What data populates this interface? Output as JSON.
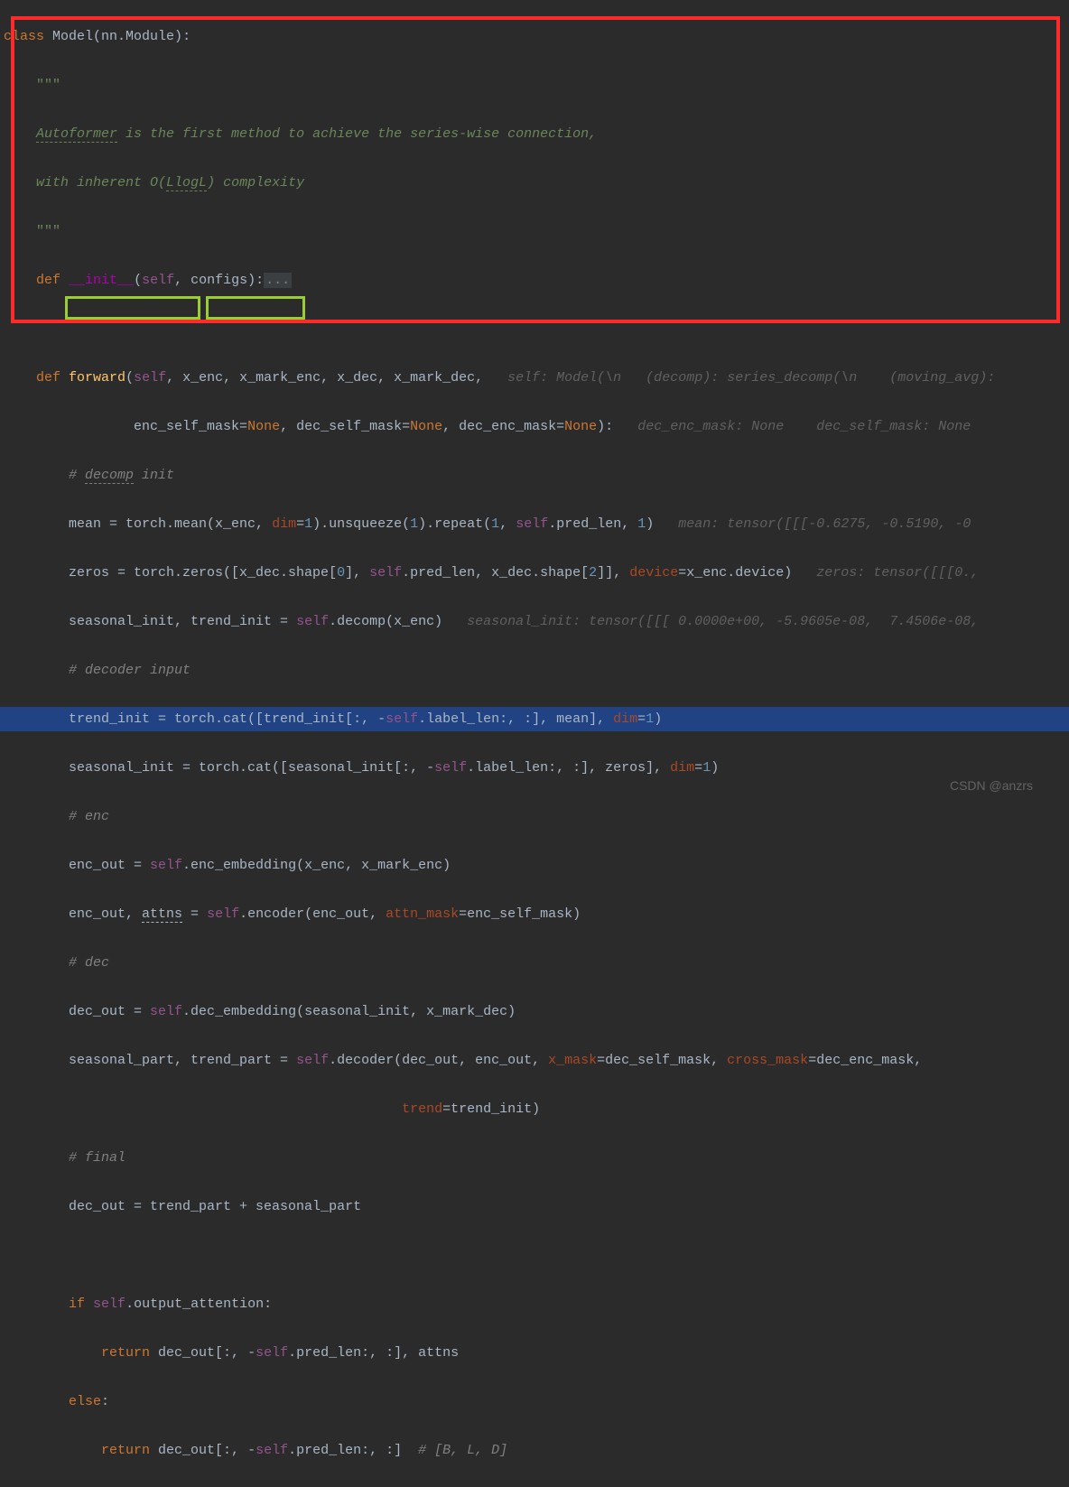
{
  "lines": {
    "class_def": {
      "kw": "class",
      "name": "Model",
      "base": "(nn.Module):"
    },
    "docq1": "\"\"\"",
    "doc1a": "Autoformer",
    "doc1b": " is the first method to achieve the series-wise connection,",
    "doc2a": "with inherent O(",
    "doc2b": "LlogL",
    "doc2c": ") complexity",
    "docq2": "\"\"\"",
    "init_def": {
      "kw": "def",
      "name": "__init__",
      "params": "(",
      "self": "self",
      "rest": ", configs):",
      "fold": "..."
    },
    "fwd_def": {
      "kw": "def",
      "name": "forward",
      "open": "(",
      "self": "self",
      "params1": ", x_enc, x_mark_enc, x_dec, x_mark_dec,",
      "hint1": "   self: Model(\\n   (decomp): series_decomp(\\n    (moving_avg):",
      "params2_a": "enc_self_mask=",
      "none1": "None",
      "c1": ", dec_self_mask=",
      "none2": "None",
      "c2": ", dec_enc_mask=",
      "none3": "None",
      "close": "):",
      "hint2": "   dec_enc_mask: None    dec_self_mask: None"
    },
    "decomp_comment": "# ",
    "decomp_word": "decomp",
    "decomp_rest": " init",
    "mean_line": {
      "a": "mean = torch.mean(x_enc, ",
      "dim": "dim",
      "b": "=",
      "n1": "1",
      "c": ").unsqueeze(",
      "n2": "1",
      "d": ").repeat(",
      "n3": "1",
      "e": ", ",
      "self": "self",
      "f": ".pred_len, ",
      "n4": "1",
      "g": ")",
      "hint": "   mean: tensor([[[-0.6275, -0.5190, -0"
    },
    "zeros_line": {
      "a": "zeros = torch.zeros([x_dec.shape[",
      "n0": "0",
      "b": "], ",
      "self": "self",
      "c": ".pred_len, x_dec.shape[",
      "n2": "2",
      "d": "]], ",
      "device": "device",
      "e": "=x_enc.device)",
      "hint": "   zeros: tensor([[[0.,"
    },
    "seasonal_line": {
      "a": "seasonal_init, trend_init = ",
      "self": "self",
      "b": ".decomp(x_enc)",
      "hint": "   seasonal_init: tensor([[[ 0.0000e+00, -5.9605e-08,  7.4506e-08,"
    },
    "decoder_comment": "# decoder input",
    "trend_init": {
      "a": "trend_init = torch.cat([trend_init[:, -",
      "self": "self",
      "b": ".label_len:, :], mean], ",
      "dim": "dim",
      "c": "=",
      "n": "1",
      "d": ")"
    },
    "seasonal_init2": {
      "a": "seasonal_init = torch.cat([seasonal_init[:, -",
      "self": "self",
      "b": ".label_len:, :], zeros], ",
      "dim": "dim",
      "c": "=",
      "n": "1",
      "d": ")"
    },
    "enc_comment": "# enc",
    "enc_out1": {
      "a": "enc_out = ",
      "self": "self",
      "b": ".enc_embedding(x_enc, x_mark_enc)"
    },
    "enc_out2": {
      "a": "enc_out, ",
      "attns": "attns",
      "b": " = ",
      "self": "self",
      "c": ".encoder(enc_out, ",
      "attn": "attn_mask",
      "d": "=enc_self_mask)"
    },
    "dec_comment": "# dec",
    "dec_out1": {
      "a": "dec_out = ",
      "self": "self",
      "b": ".dec_embedding(seasonal_init, x_mark_dec)"
    },
    "dec_out2": {
      "a": "seasonal_part, trend_part = ",
      "self": "self",
      "b": ".decoder(dec_out, enc_out, ",
      "xmask": "x_mask",
      "c": "=dec_self_mask, ",
      "cmask": "cross_mask",
      "d": "=dec_enc_mask,"
    },
    "dec_out2b": {
      "trend": "trend",
      "a": "=trend_init)"
    },
    "final_comment": "# final",
    "final_line": "dec_out = trend_part + seasonal_part",
    "if_line": {
      "kw": "if",
      "sp": " ",
      "self": "self",
      "a": ".output_attention:"
    },
    "return1": {
      "kw": "return",
      "a": " dec_out[:, -",
      "self": "self",
      "b": ".pred_len:, :], attns"
    },
    "else_line": {
      "kw": "else",
      "a": ":"
    },
    "return2": {
      "kw": "return",
      "a": " dec_out[:, -",
      "self": "self",
      "b": ".pred_len:, :]  ",
      "comment": "# [B, L, D]"
    }
  },
  "watermark1": "CSDN @anzrs",
  "watermark2": ""
}
